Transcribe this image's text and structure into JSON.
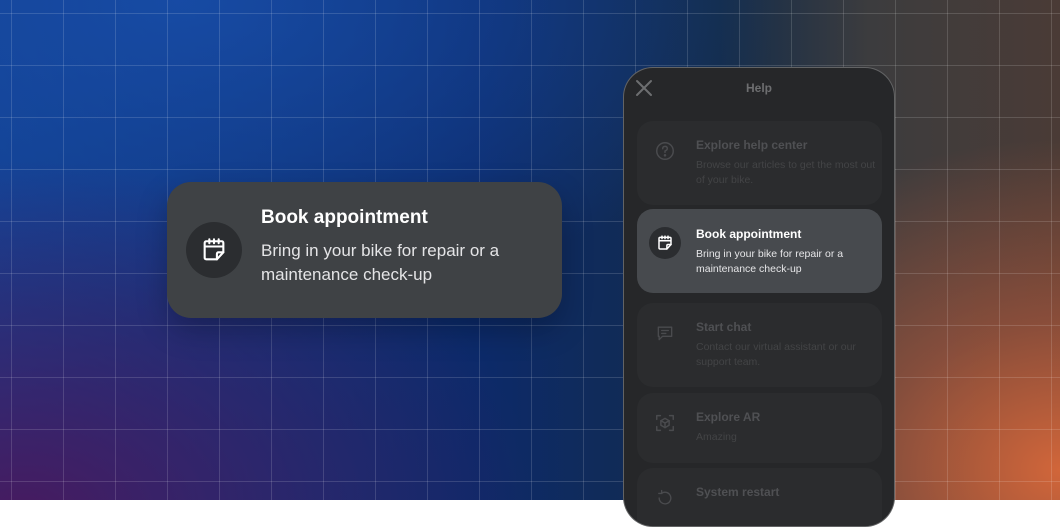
{
  "featured_card": {
    "title": "Book appointment",
    "description": "Bring in your bike for repair or a maintenance check-up",
    "icon": "calendar-icon"
  },
  "phone": {
    "header_title": "Help",
    "close_icon": "close-icon",
    "items": [
      {
        "title": "Explore help center",
        "description": "Browse our articles to get the most out of your bike.",
        "icon": "question-circle-icon",
        "active": false
      },
      {
        "title": "Book appointment",
        "description": "Bring in your bike for repair or a maintenance check-up",
        "icon": "calendar-icon",
        "active": true
      },
      {
        "title": "Start chat",
        "description": "Contact our virtual assistant or our support team.",
        "icon": "chat-icon",
        "active": false
      },
      {
        "title": "Explore AR",
        "description": "Amazing",
        "icon": "ar-cube-icon",
        "active": false
      },
      {
        "title": "System restart",
        "description": "",
        "icon": "restart-icon",
        "active": false
      }
    ]
  },
  "colors": {
    "card_background": "#3f4245",
    "phone_background": "#262729",
    "accent_orange": "#d8683a",
    "accent_blue": "#123f8e"
  }
}
